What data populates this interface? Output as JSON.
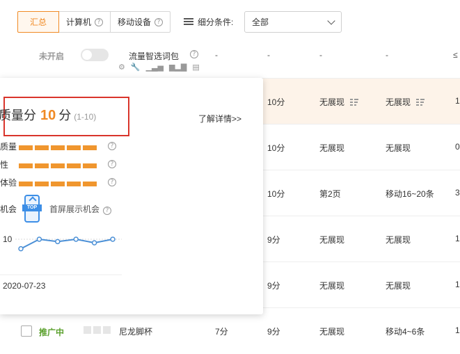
{
  "tabs": [
    {
      "label": "汇总",
      "active": true,
      "help": false
    },
    {
      "label": "计算机",
      "active": false,
      "help": true
    },
    {
      "label": "移动设备",
      "active": false,
      "help": true
    }
  ],
  "filter": {
    "label": "细分条件:",
    "value": "全部"
  },
  "top_row": {
    "status": "未开启",
    "flow_label": "流量智选词包",
    "help": "?",
    "dashes": [
      "-",
      "-",
      "-",
      "-"
    ],
    "right_edge": "≤"
  },
  "rows": [
    {
      "score": "10分",
      "pc_rank": "无展现",
      "mobile_rank": "无展现",
      "edge": "1",
      "sortable": true,
      "highlight": true
    },
    {
      "score": "10分",
      "pc_rank": "无展现",
      "mobile_rank": "无展现",
      "edge": "0",
      "sortable": false,
      "highlight": false
    },
    {
      "score": "10分",
      "pc_rank": "第2页",
      "mobile_rank": "移动16~20条",
      "edge": "3",
      "sortable": false,
      "highlight": false
    },
    {
      "score": "9分",
      "pc_rank": "无展现",
      "mobile_rank": "无展现",
      "edge": "1",
      "sortable": false,
      "highlight": false
    },
    {
      "score": "9分",
      "pc_rank": "无展现",
      "mobile_rank": "无展现",
      "edge": "1",
      "sortable": false,
      "highlight": false
    }
  ],
  "bottom_row": {
    "status": "推广中",
    "product": "尼龙脚杯",
    "score_a": "7分",
    "score_b": "9分",
    "pc_rank": "无展现",
    "mobile_rank": "移动4~6条",
    "edge": "1"
  },
  "popup": {
    "title": "质量分",
    "score": "10",
    "unit": "分",
    "range": "(1-10)",
    "detail_link": "了解详情>>",
    "metrics": [
      {
        "label": "质量",
        "level": 1.0
      },
      {
        "label": "性",
        "level": 1.0
      },
      {
        "label": "体验",
        "level": 1.0
      }
    ],
    "opportunity_label": "机会",
    "screen_label": "首屏展示机会",
    "help": "?"
  },
  "chart_data": {
    "type": "line",
    "ytick": "10",
    "xtick": "2020-07-23",
    "values": [
      9.2,
      10,
      9.8,
      10,
      9.7,
      10
    ]
  },
  "colors": {
    "accent": "#f08a24",
    "highlight": "#fdf3e9",
    "active_green": "#5aa02c",
    "frame_red": "#d9342b",
    "line_blue": "#3c8ee6"
  }
}
